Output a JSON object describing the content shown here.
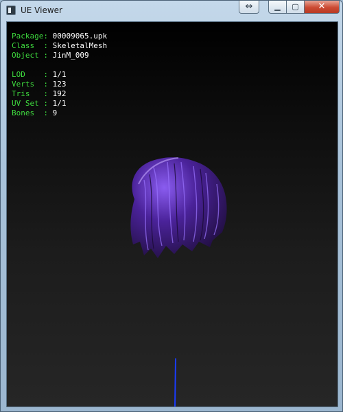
{
  "window": {
    "title": "UE Viewer",
    "resize_glyph": "⇔",
    "minimize_glyph": "▁",
    "maximize_glyph": "▢",
    "close_glyph": "✕"
  },
  "info": {
    "package": {
      "label": "Package:",
      "value": "00009065.upk"
    },
    "class": {
      "label": "Class  :",
      "value": "SkeletalMesh"
    },
    "object": {
      "label": "Object :",
      "value": "JinM_009"
    },
    "lod": {
      "label": "LOD    :",
      "value": "1/1"
    },
    "verts": {
      "label": "Verts  :",
      "value": "123"
    },
    "tris": {
      "label": "Tris   :",
      "value": "192"
    },
    "uvset": {
      "label": "UV Set :",
      "value": "1/1"
    },
    "bones": {
      "label": "Bones  :",
      "value": "9"
    }
  },
  "colors": {
    "label_green": "#3fdc3f",
    "mesh_purple": "#5a2bc4",
    "bone_line": "#1a3cff"
  },
  "icons": {
    "app": "ue-viewer-app-icon",
    "mesh": "hair-mesh-render"
  }
}
